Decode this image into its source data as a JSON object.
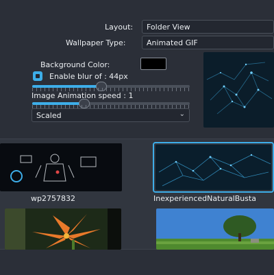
{
  "layout": {
    "label": "Layout:",
    "value": "Folder View"
  },
  "wallpaper_type": {
    "label": "Wallpaper Type:",
    "value": "Animated GIF"
  },
  "background_color": {
    "label": "Background Color:",
    "color": "#000000"
  },
  "blur": {
    "checked": true,
    "label": "Enable blur of : 44px",
    "level_fraction": 0.44
  },
  "animation_speed": {
    "label": "Image Animation speed : 1",
    "level_fraction": 0.33
  },
  "fill_mode": {
    "value": "Scaled"
  },
  "wallpapers": [
    {
      "name": "wp2757832",
      "selected": false
    },
    {
      "name": "InexperiencedNaturalBusta",
      "selected": true
    },
    {
      "name": "",
      "selected": false
    },
    {
      "name": "",
      "selected": false
    }
  ],
  "colors": {
    "accent": "#3daee9",
    "background": "#2b2f38"
  }
}
